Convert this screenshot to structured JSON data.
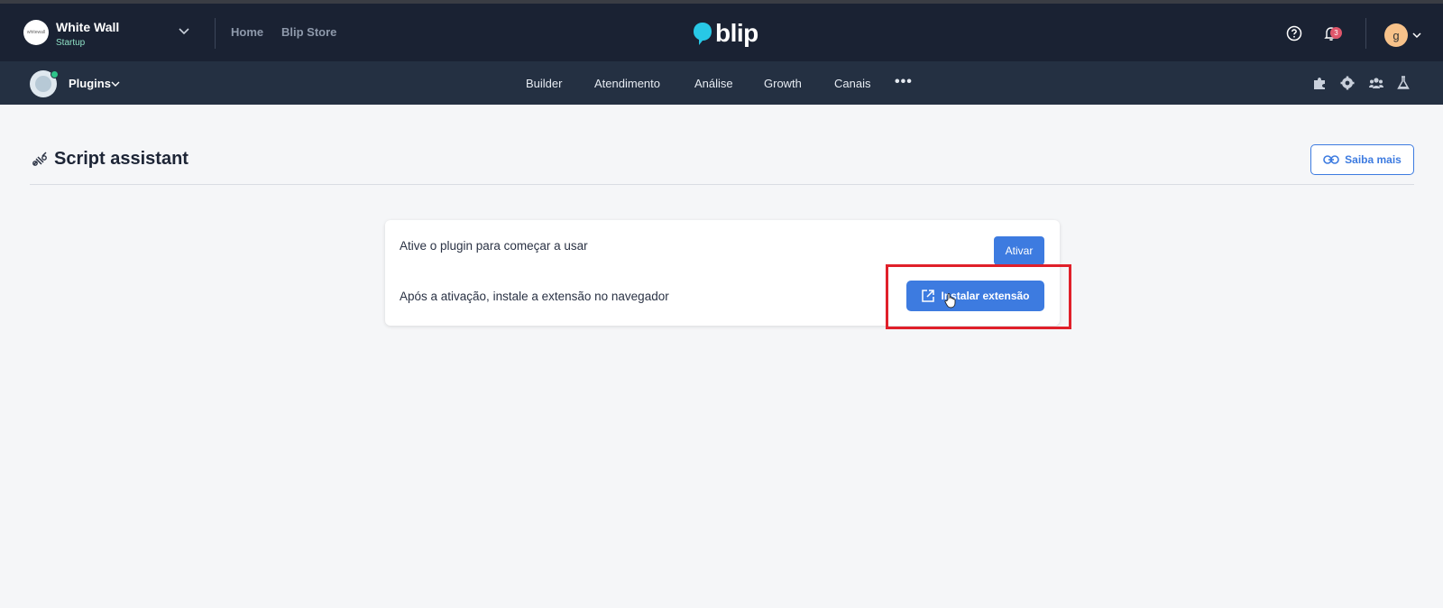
{
  "org": {
    "name": "White Wall",
    "plan": "Startup",
    "logo_text": "whitewall"
  },
  "topnav": {
    "home": "Home",
    "store": "Blip Store"
  },
  "brand": {
    "name": "blip",
    "accent": "#28c8e6"
  },
  "notifications": {
    "count": "3"
  },
  "user": {
    "initial": "g"
  },
  "plugin": {
    "label": "Plugins"
  },
  "nav": {
    "items": [
      "Builder",
      "Atendimento",
      "Análise",
      "Growth",
      "Canais"
    ],
    "more": "•••"
  },
  "page": {
    "title": "Script assistant",
    "learn_more": "Saiba mais"
  },
  "card": {
    "activate_text": "Ative o plugin para começar a usar",
    "activate_button": "Ativar",
    "install_text": "Após a ativação, instale a extensão no navegador",
    "install_button": "Instalar extensão"
  },
  "colors": {
    "topbar": "#1a2233",
    "navbar": "#243042",
    "primary": "#3d7be0",
    "highlight": "#e0202a",
    "badge": "#e0566b"
  }
}
